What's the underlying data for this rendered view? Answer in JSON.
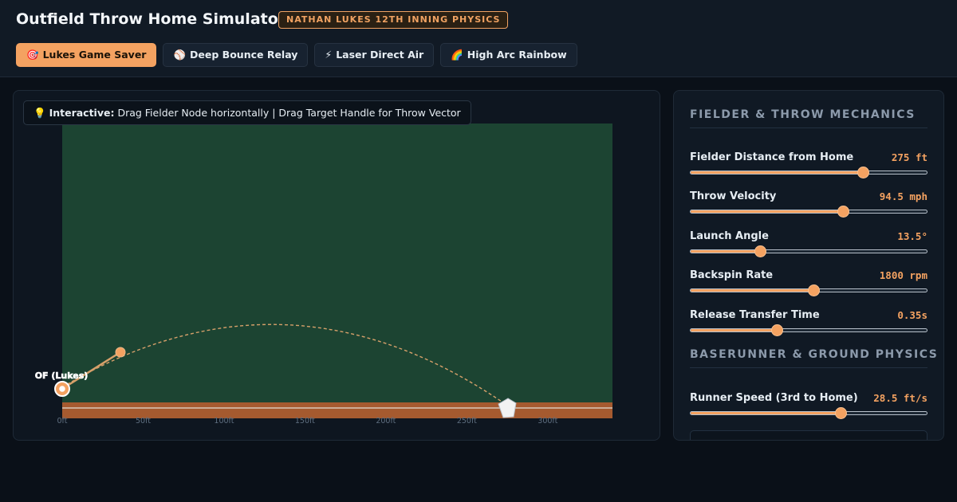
{
  "header": {
    "title": "Outfield Throw Home Simulator",
    "badge": "NATHAN LUKES 12TH INNING PHYSICS"
  },
  "presets": [
    {
      "icon": "🎯",
      "icon_name": "target-icon",
      "label": "Lukes Game Saver",
      "active": true
    },
    {
      "icon": "⚾",
      "icon_name": "baseball-icon",
      "label": "Deep Bounce Relay",
      "active": false
    },
    {
      "icon": "⚡",
      "icon_name": "lightning-icon",
      "label": "Laser Direct Air",
      "active": false
    },
    {
      "icon": "🌈",
      "icon_name": "rainbow-icon",
      "label": "High Arc Rainbow",
      "active": false
    }
  ],
  "field": {
    "hint_icon": "💡",
    "hint_icon_name": "lightbulb-icon",
    "hint_bold": "Interactive:",
    "hint_text": " Drag Fielder Node horizontally | Drag Target Handle for Throw Vector",
    "fielder_label": "OF (Lukes)",
    "axis_ticks": [
      "0ft",
      "50ft",
      "100ft",
      "150ft",
      "200ft",
      "250ft",
      "300ft"
    ],
    "axis_tick_values": [
      0,
      50,
      100,
      150,
      200,
      250,
      300
    ],
    "axis_max": 340,
    "fielder_distance_ft": 275,
    "colors": {
      "grass": "#1c4432",
      "dirt": "#a55a2f",
      "accent": "#f4a261"
    }
  },
  "controls": {
    "section1_title": "FIELDER & THROW MECHANICS",
    "section2_title": "BASERUNNER & GROUND PHYSICS",
    "items": [
      {
        "label": "Fielder Distance from Home",
        "value": "275 ft",
        "fraction": 0.73
      },
      {
        "label": "Throw Velocity",
        "value": "94.5 mph",
        "fraction": 0.645
      },
      {
        "label": "Launch Angle",
        "value": "13.5°",
        "fraction": 0.295
      },
      {
        "label": "Backspin Rate",
        "value": "1800 rpm",
        "fraction": 0.52
      },
      {
        "label": "Release Transfer Time",
        "value": "0.35s",
        "fraction": 0.365
      },
      {
        "label": "Runner Speed (3rd to Home)",
        "value": "28.5 ft/s",
        "fraction": 0.635
      }
    ]
  }
}
